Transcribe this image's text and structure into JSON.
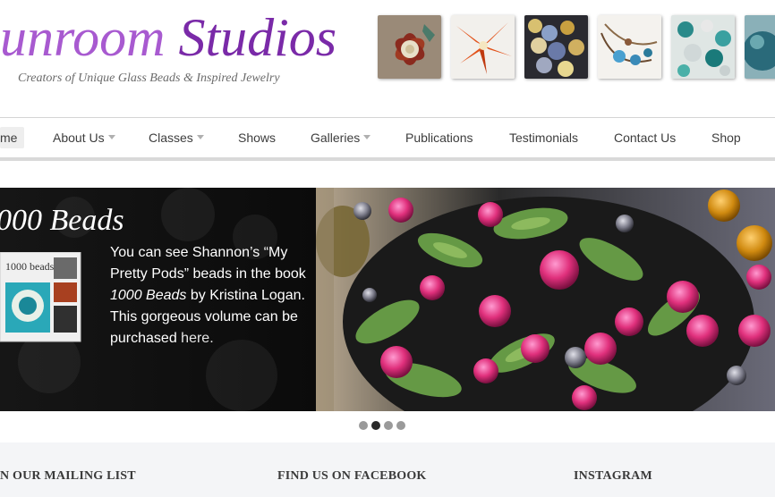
{
  "header": {
    "logo_part_a": "unroom",
    "logo_part_b": "Studios",
    "tagline": "Creators of Unique Glass Beads & Inspired Jewelry"
  },
  "thumbnails": [
    {
      "icon": "flower-bead-thumbnail",
      "color": "#8a3a2a"
    },
    {
      "icon": "lily-bead-thumbnail",
      "color": "#e0501a"
    },
    {
      "icon": "bead-strand-thumbnail",
      "color": "#3a4a6a"
    },
    {
      "icon": "necklace-thumbnail",
      "color": "#7a5a40"
    },
    {
      "icon": "teal-beads-thumbnail",
      "color": "#2a8a8a"
    },
    {
      "icon": "blue-bead-thumbnail",
      "color": "#2a6a7a"
    }
  ],
  "nav": {
    "items": [
      {
        "label": "me",
        "active": true,
        "dropdown": false
      },
      {
        "label": "About Us",
        "dropdown": true
      },
      {
        "label": "Classes",
        "dropdown": true
      },
      {
        "label": "Shows",
        "dropdown": false
      },
      {
        "label": "Galleries",
        "dropdown": true
      },
      {
        "label": "Publications",
        "dropdown": false
      },
      {
        "label": "Testimonials",
        "dropdown": false
      },
      {
        "label": "Contact Us",
        "dropdown": false
      },
      {
        "label": "Shop",
        "dropdown": false
      }
    ]
  },
  "slider": {
    "title": "000 Beads",
    "text_before": "You can see Shannon’s “My Pretty Pods” beads in the book ",
    "book_title": "1000 Beads",
    "text_after": " by Kristina Logan. This gorgeous volume can be purchased ",
    "link_text": "here.",
    "book_cover_text": "1000 beads",
    "active_dot": 2,
    "dot_count": 4
  },
  "footer": {
    "mailing_title": "N OUR MAILING LIST",
    "facebook_title": "FIND US ON FACEBOOK",
    "instagram_title": "INSTAGRAM"
  },
  "colors": {
    "logo_purple": "#7a2aa8",
    "nav_text": "#3d3d3d",
    "slider_bg": "#0d0d0d"
  }
}
